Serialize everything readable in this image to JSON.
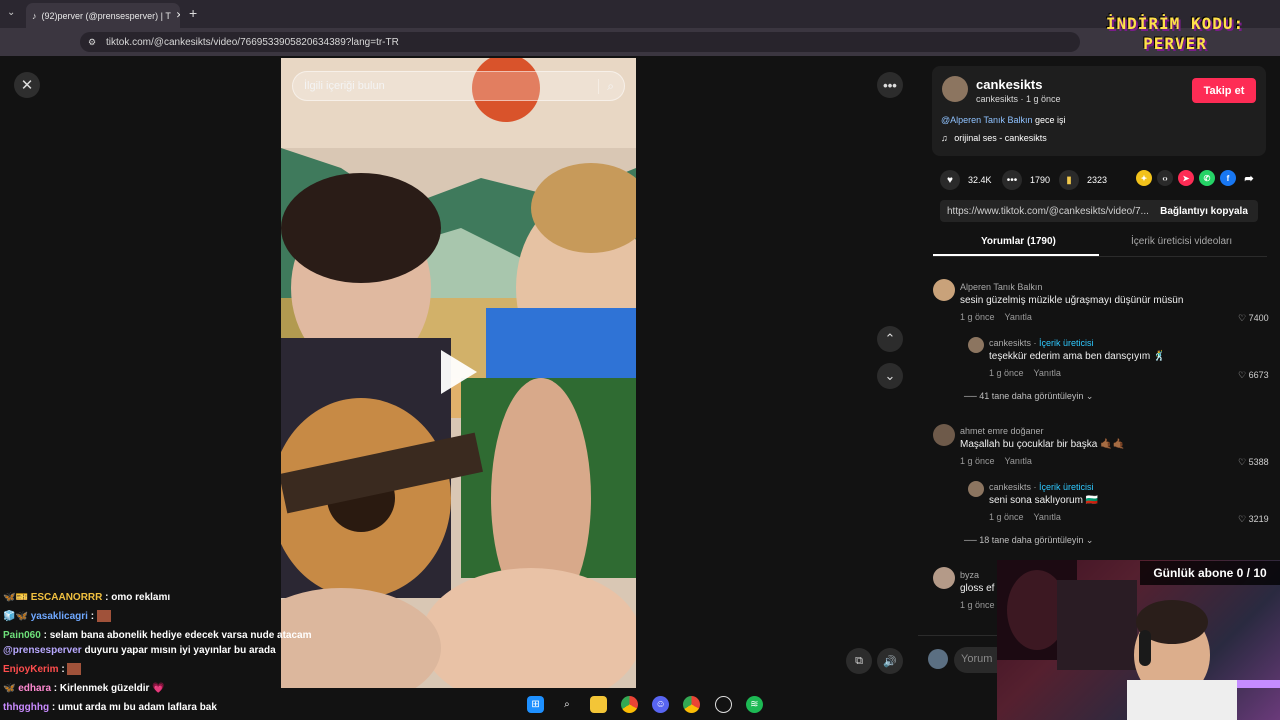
{
  "browser": {
    "tab_title": "(92)perver (@prensesperver) | T",
    "url": "tiktok.com/@cankesikts/video/7669533905820634389?lang=tr-TR"
  },
  "promo": {
    "line1": "İNDİRİM KODU:",
    "line2": "PERVER"
  },
  "video": {
    "search_placeholder": "İlgili içeriği bulun"
  },
  "author": {
    "username": "cankesikts",
    "subtitle": "cankesikts · 1 g önce",
    "follow_label": "Takip et",
    "caption_mention": "@Alperen Tanık Balkın",
    "caption_text": " gece işi",
    "sound": "orijinal ses - cankesikts"
  },
  "stats": {
    "likes": "32.4K",
    "comments": "1790",
    "saves": "2323"
  },
  "share": {
    "link": "https://www.tiktok.com/@cankesikts/video/7...",
    "copy_label": "Bağlantıyı kopyala"
  },
  "tabs": {
    "comments": "Yorumlar (1790)",
    "creator_videos": "İçerik üreticisi videoları"
  },
  "comments": [
    {
      "name": "Alperen Tanık Balkın",
      "text": "sesin güzelmiş müzikle uğraşmayı düşünür müsün",
      "time": "1 g önce",
      "reply": "Yanıtla",
      "likes": "7400"
    },
    {
      "name": "cankesikts",
      "badge": "İçerik üreticisi",
      "text": "teşekkür ederim ama ben dansçıyım 🕺",
      "time": "1 g önce",
      "reply": "Yanıtla",
      "likes": "6673"
    },
    {
      "more": "41 tane daha görüntüleyin"
    },
    {
      "name": "ahmet emre doğaner",
      "text": "Maşallah bu çocuklar bir başka 🤙🏾🤙🏾",
      "time": "1 g önce",
      "reply": "Yanıtla",
      "likes": "5388"
    },
    {
      "name": "cankesikts",
      "badge": "İçerik üreticisi",
      "text": "seni sona saklıyorum 🇧🇬",
      "time": "1 g önce",
      "reply": "Yanıtla",
      "likes": "3219"
    },
    {
      "more": "18 tane daha görüntüleyin"
    },
    {
      "name": "byza",
      "text": "gloss ef",
      "time": "1 g önce"
    }
  ],
  "comment_input_placeholder": "Yorum",
  "chat": [
    {
      "user": "ESCAANORRR",
      "sep": " : ",
      "msg": "omo reklamı",
      "color": "#f0c040"
    },
    {
      "user": "yasaklicagri",
      "sep": " : ",
      "msg": "",
      "color": "#6fa8ff"
    },
    {
      "user": "Pain060",
      "sep": " : ",
      "msg": "selam bana abonelik hediye edecek varsa nude atacam",
      "color": "#6ee07a"
    },
    {
      "user": "@prensesperver",
      "sep": " ",
      "msg": "duyuru yapar mısın iyi yayınlar bu arada",
      "color": "#b9a9ff"
    },
    {
      "user": "EnjoyKerim",
      "sep": " : ",
      "msg": "",
      "color": "#ff4d4d"
    },
    {
      "user": "edhara",
      "sep": " : ",
      "msg": "Kirlenmek güzeldir 💗",
      "color": "#ff8ad1"
    },
    {
      "user": "thhgghhg",
      "sep": " : ",
      "msg": "umut arda mı bu adam laflara bak",
      "color": "#c98bff"
    }
  ],
  "subs_counter": "Günlük abone 0 / 10"
}
